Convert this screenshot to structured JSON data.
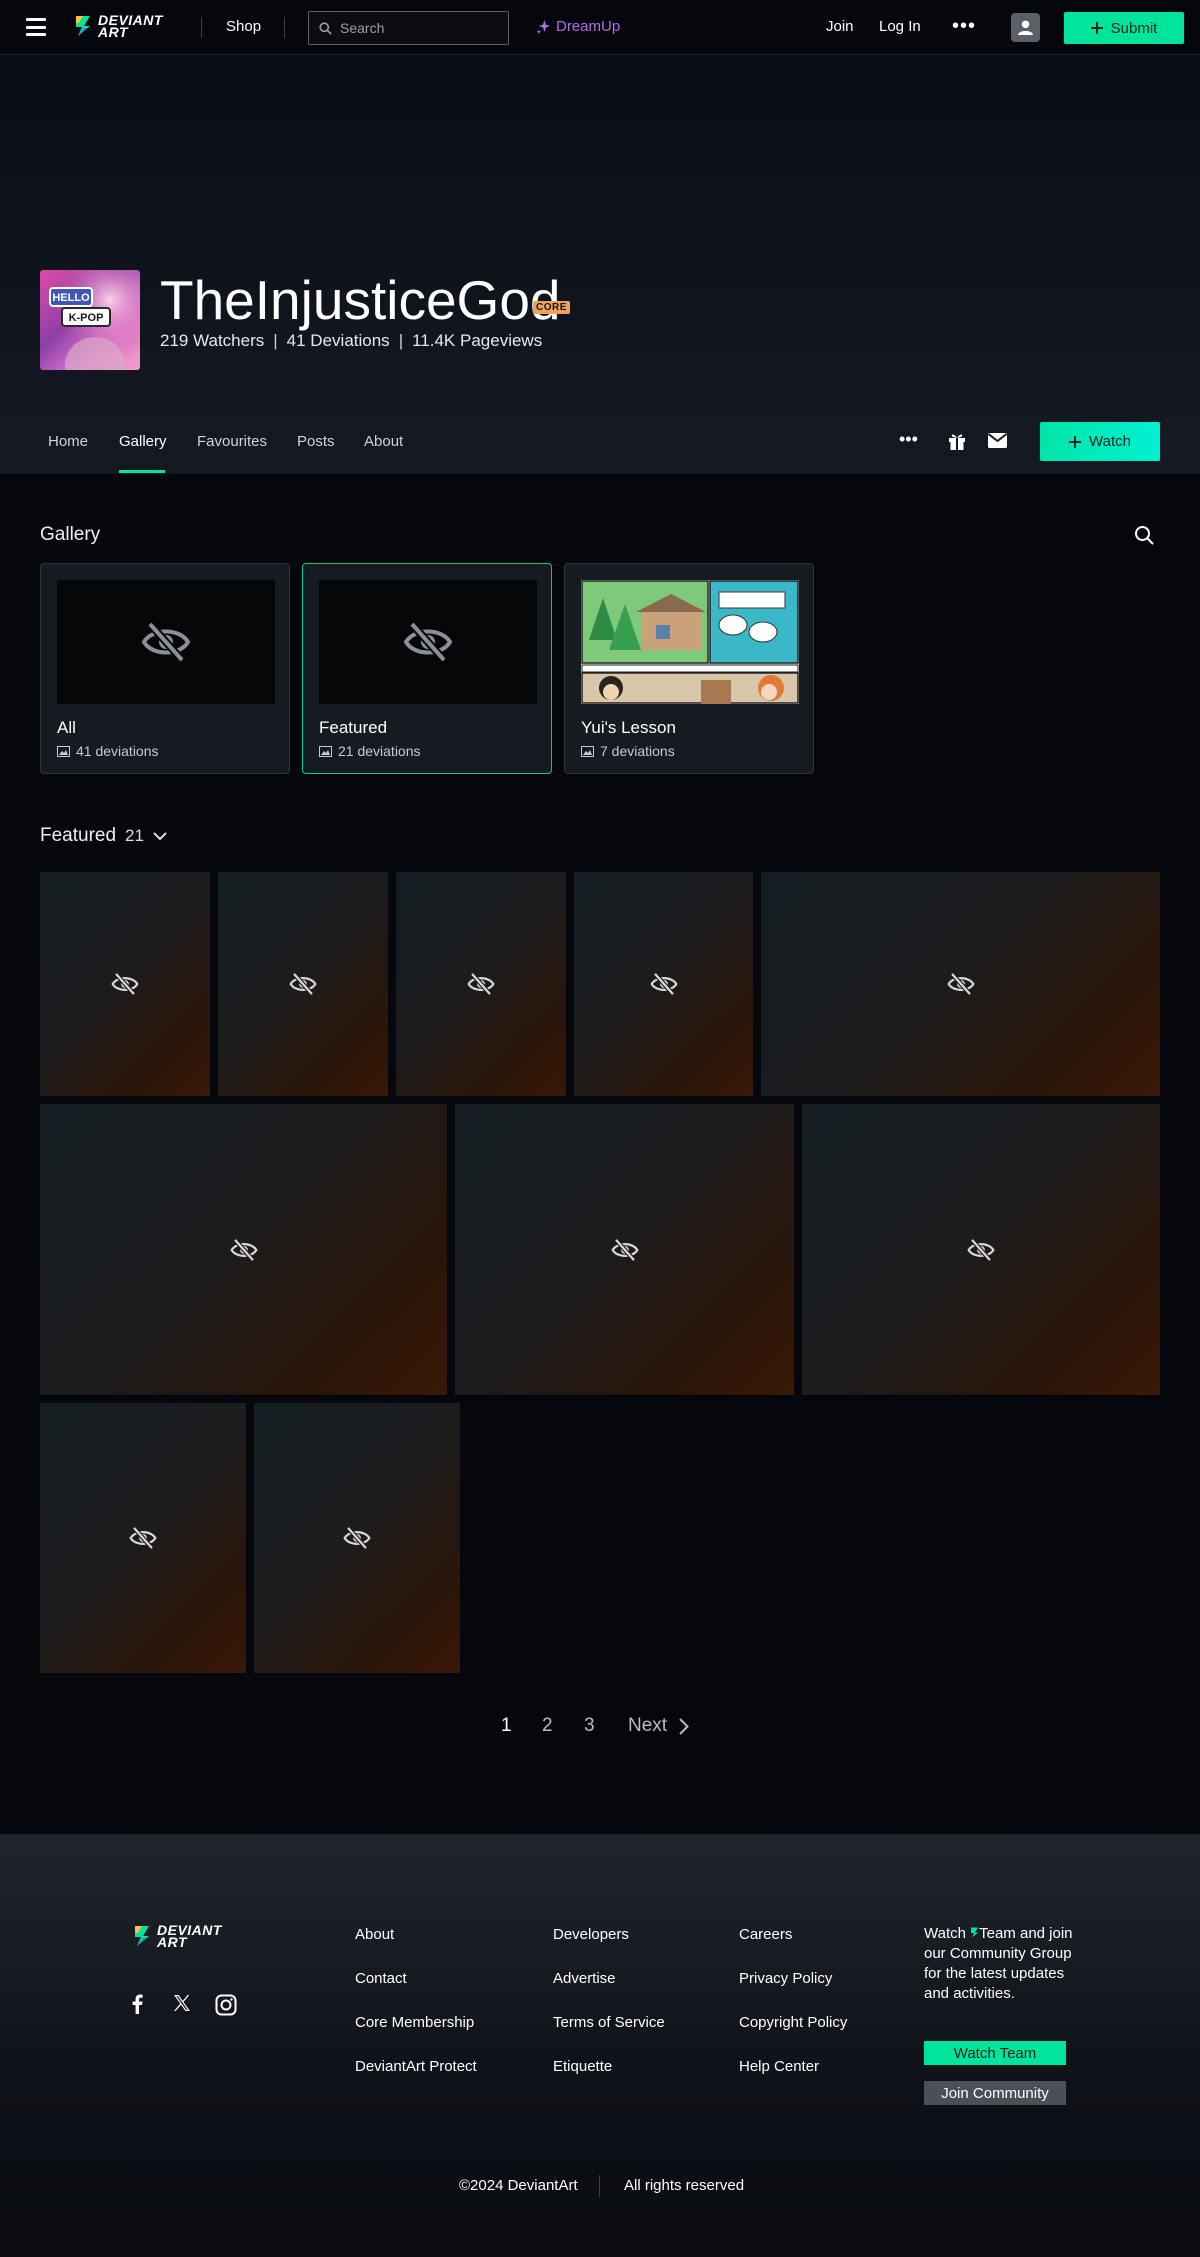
{
  "topbar": {
    "logo_line1": "DEVIANT",
    "logo_line2": "ART",
    "shop": "Shop",
    "search_placeholder": "Search",
    "dreamup": "DreamUp",
    "join": "Join",
    "login": "Log In",
    "more": "•••",
    "submit": "Submit",
    "accent_color": "#00e59b"
  },
  "profile": {
    "avatar_text_1": "HELLO",
    "avatar_text_2": "K-POP",
    "username": "TheInjusticeGod",
    "badge": "CORE",
    "watchers": "219 Watchers",
    "deviations": "41 Deviations",
    "pageviews": "11.4K Pageviews",
    "separator": "|"
  },
  "nav": {
    "tabs": [
      {
        "label": "Home"
      },
      {
        "label": "Gallery",
        "active": true
      },
      {
        "label": "Favourites"
      },
      {
        "label": "Posts"
      },
      {
        "label": "About"
      }
    ],
    "more": "•••",
    "watch": "Watch"
  },
  "gallery": {
    "title": "Gallery",
    "folders": [
      {
        "name": "All",
        "count": "41 deviations",
        "thumb": "hidden-icon"
      },
      {
        "name": "Featured",
        "count": "21 deviations",
        "thumb": "hidden-icon",
        "selected": true
      },
      {
        "name": "Yui's Lesson",
        "count": "7 deviations",
        "thumb": "comic-preview"
      }
    ]
  },
  "featured": {
    "title": "Featured",
    "count": "21"
  },
  "pagination": {
    "pages": [
      "1",
      "2",
      "3"
    ],
    "current": "1",
    "next": "Next"
  },
  "footer": {
    "logo_line1": "DEVIANT",
    "logo_line2": "ART",
    "col1": [
      "About",
      "Contact",
      "Core Membership",
      "DeviantArt Protect"
    ],
    "col2": [
      "Developers",
      "Advertise",
      "Terms of Service",
      "Etiquette"
    ],
    "col3": [
      "Careers",
      "Privacy Policy",
      "Copyright Policy",
      "Help Center"
    ],
    "watch_team_pre": "Watch",
    "watch_team_post": "Team and join our Community Group for the latest updates and activities.",
    "watch_team_btn": "Watch Team",
    "join_community_btn": "Join Community",
    "copyright": "©2024 DeviantArt",
    "rights": "All rights reserved"
  }
}
